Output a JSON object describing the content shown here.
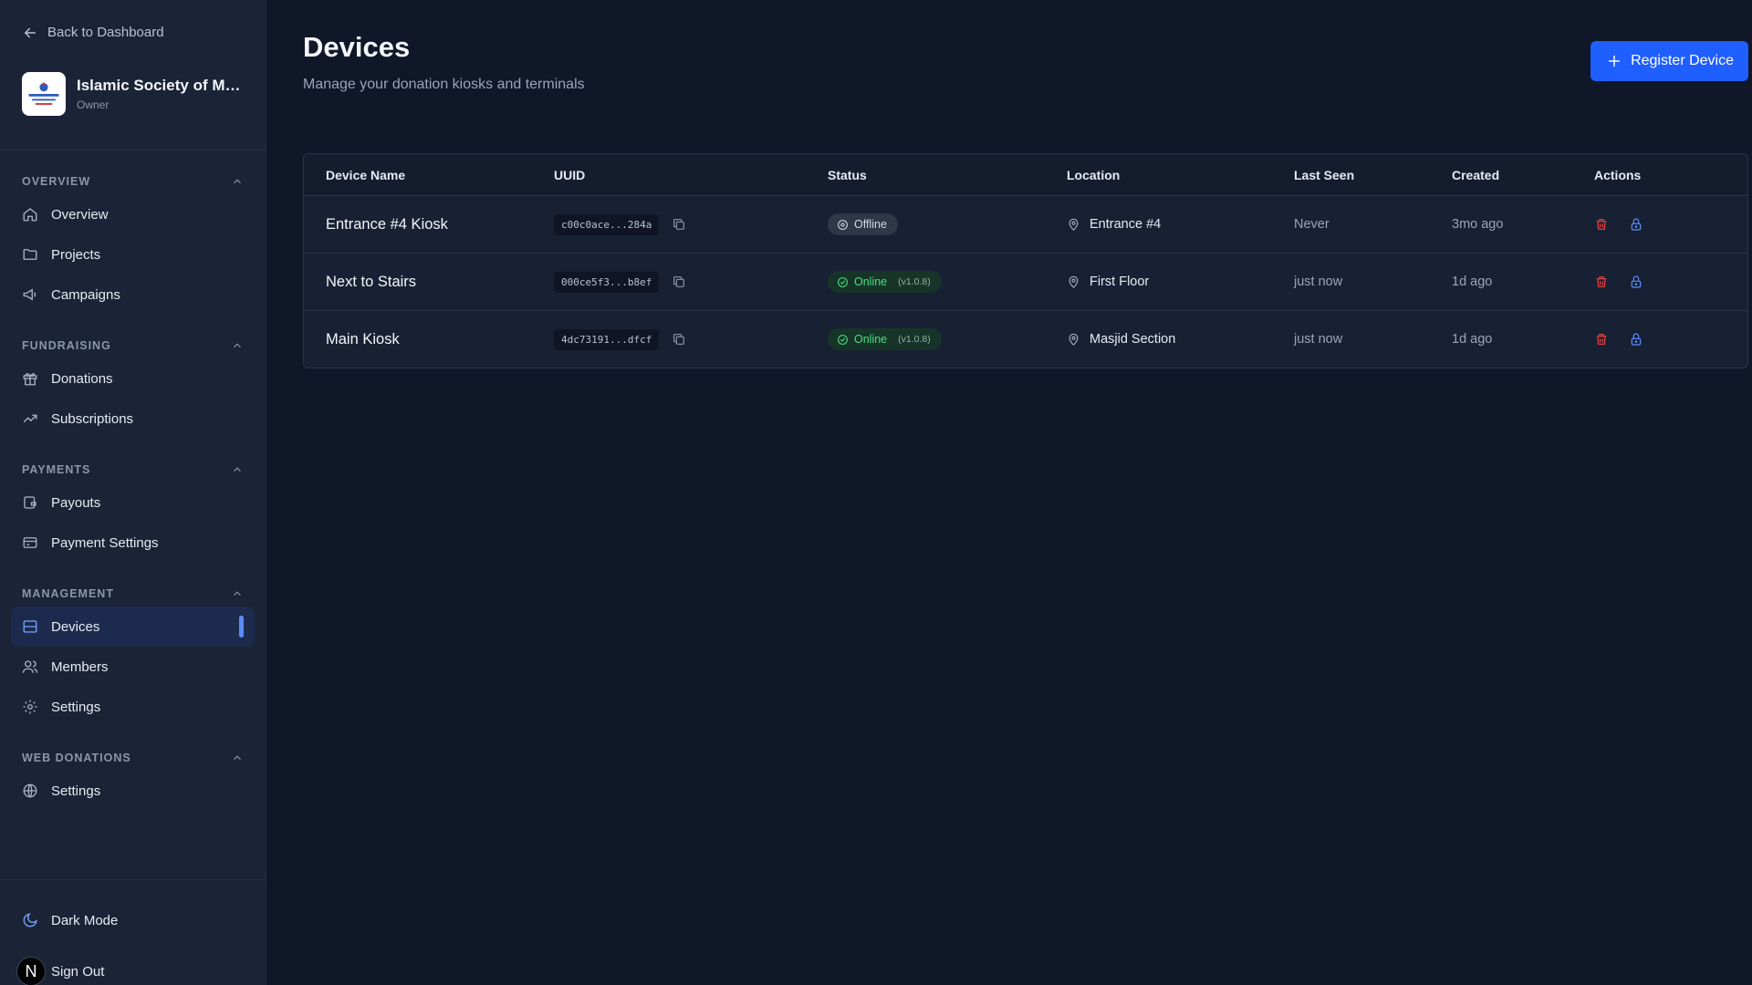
{
  "sidebar": {
    "back_label": "Back to Dashboard",
    "org_name": "Islamic Society of Mi...",
    "org_role": "Owner",
    "sections": [
      {
        "title": "OVERVIEW",
        "items": [
          {
            "label": "Overview",
            "icon": "home-icon"
          },
          {
            "label": "Projects",
            "icon": "folder-icon"
          },
          {
            "label": "Campaigns",
            "icon": "megaphone-icon"
          }
        ]
      },
      {
        "title": "FUNDRAISING",
        "items": [
          {
            "label": "Donations",
            "icon": "gift-icon"
          },
          {
            "label": "Subscriptions",
            "icon": "trending-up-icon"
          }
        ]
      },
      {
        "title": "PAYMENTS",
        "items": [
          {
            "label": "Payouts",
            "icon": "wallet-icon"
          },
          {
            "label": "Payment Settings",
            "icon": "credit-card-icon"
          }
        ]
      },
      {
        "title": "MANAGEMENT",
        "items": [
          {
            "label": "Devices",
            "icon": "server-icon",
            "active": true
          },
          {
            "label": "Members",
            "icon": "users-icon"
          },
          {
            "label": "Settings",
            "icon": "gear-icon"
          }
        ]
      },
      {
        "title": "WEB DONATIONS",
        "items": [
          {
            "label": "Settings",
            "icon": "globe-icon"
          }
        ]
      }
    ],
    "dark_mode_label": "Dark Mode",
    "sign_out_label": "Sign Out",
    "avatar_letter": "N"
  },
  "page": {
    "title": "Devices",
    "subtitle": "Manage your donation kiosks and terminals",
    "register_button": "Register Device"
  },
  "table": {
    "headers": [
      "Device Name",
      "UUID",
      "Status",
      "Location",
      "Last Seen",
      "Created",
      "Actions"
    ],
    "rows": [
      {
        "name": "Entrance #4 Kiosk",
        "uuid": "c00c0ace...284a",
        "status": "Offline",
        "version": "",
        "location": "Entrance #4",
        "last_seen": "Never",
        "created": "3mo ago"
      },
      {
        "name": "Next to Stairs",
        "uuid": "000ce5f3...b8ef",
        "status": "Online",
        "version": "(v1.0.8)",
        "location": "First Floor",
        "last_seen": "just now",
        "created": "1d ago"
      },
      {
        "name": "Main Kiosk",
        "uuid": "4dc73191...dfcf",
        "status": "Online",
        "version": "(v1.0.8)",
        "location": "Masjid Section",
        "last_seen": "just now",
        "created": "1d ago"
      }
    ]
  },
  "colors": {
    "accent": "#1f5eff",
    "online": "#4ade80",
    "delete": "#ef4444",
    "lock": "#5b8cff"
  }
}
